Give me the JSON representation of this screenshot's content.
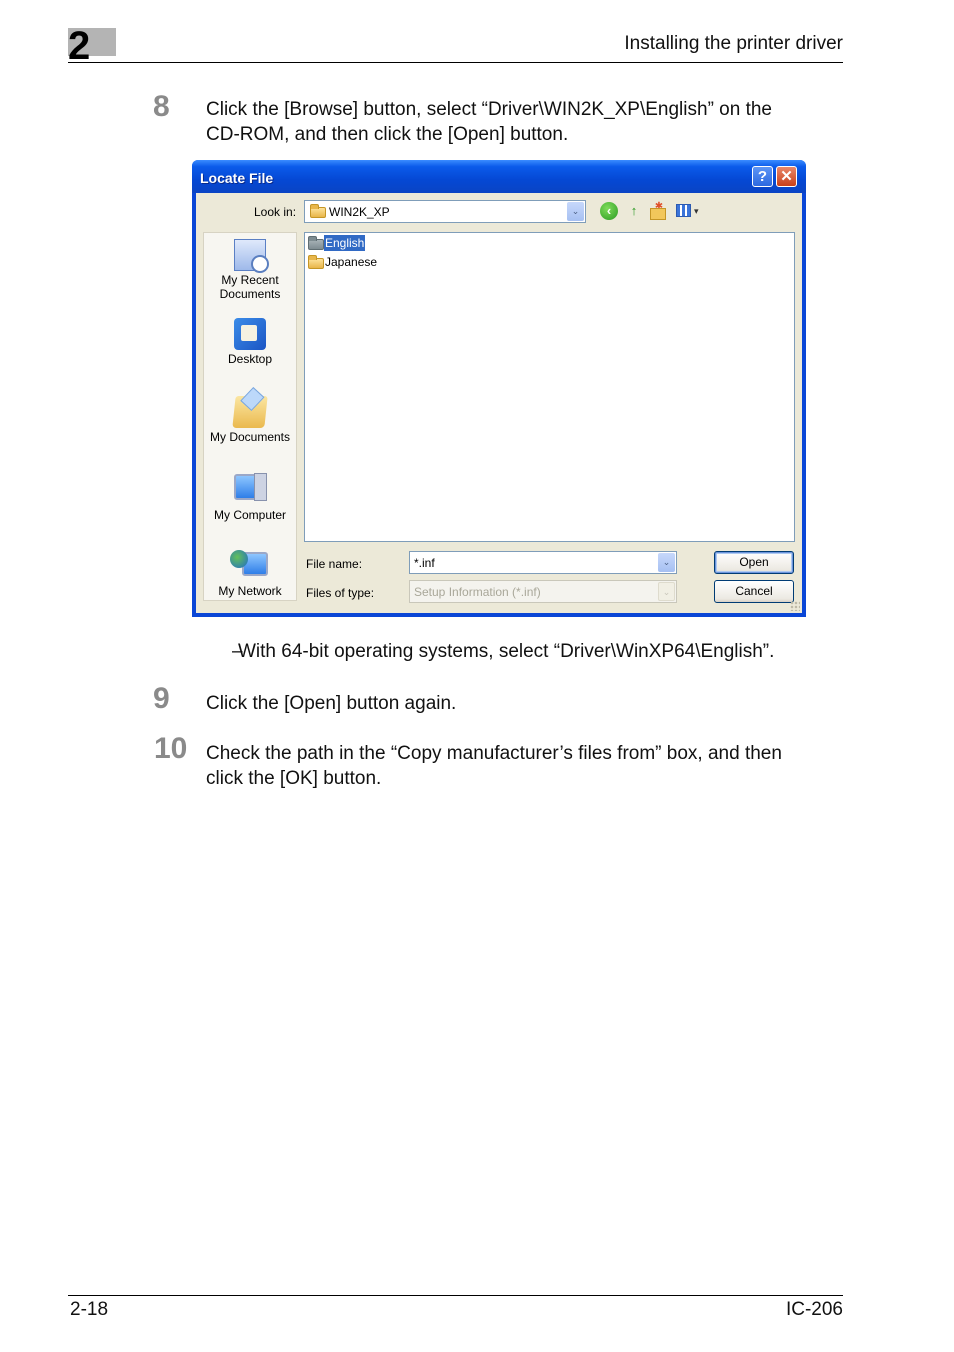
{
  "header": {
    "chapter_number": "2",
    "section_title": "Installing the printer driver"
  },
  "steps": [
    {
      "number": "8",
      "text_line1": "Click the [Browse] button, select “Driver\\WIN2K_XP\\English” on the",
      "text_line2": "CD-ROM, and then click the [Open] button."
    },
    {
      "number": "9",
      "text_line1": "Click the [Open] button again."
    },
    {
      "number": "10",
      "text_line1": "Check the path in the “Copy manufacturer’s files from” box, and then",
      "text_line2": "click the [OK] button."
    }
  ],
  "note": {
    "dash": "–",
    "text": "With 64-bit operating systems, select “Driver\\WinXP64\\English”."
  },
  "dialog": {
    "title": "Locate File",
    "help_button": "?",
    "close_button": "✕",
    "look_in_label": "Look in:",
    "look_in_value": "WIN2K_XP",
    "toolbar_icons": [
      "back-icon",
      "up-folder-icon",
      "new-folder-icon",
      "views-menu-icon"
    ],
    "places": [
      {
        "label_line1": "My Recent",
        "label_line2": "Documents",
        "icon": "recent-documents-icon"
      },
      {
        "label_line1": "Desktop",
        "icon": "desktop-icon"
      },
      {
        "label_line1": "My Documents",
        "icon": "my-documents-icon"
      },
      {
        "label_line1": "My Computer",
        "icon": "my-computer-icon"
      },
      {
        "label_line1": "My Network",
        "icon": "my-network-icon"
      }
    ],
    "files": [
      {
        "name": "English",
        "selected": true
      },
      {
        "name": "Japanese",
        "selected": false
      }
    ],
    "file_name_label": "File name:",
    "file_name_value": "*.inf",
    "file_type_label": "Files of type:",
    "file_type_value": "Setup Information (*.inf)",
    "open_button": "Open",
    "cancel_button": "Cancel",
    "dropdown_glyph": "⌄"
  },
  "footer": {
    "page_number": "2-18",
    "model": "IC-206"
  },
  "colors": {
    "titlebar_blue": "#0548d4",
    "selection_blue": "#316ac5",
    "dialog_face": "#ece9d8",
    "step_number_gray": "#8a8a8a",
    "chapter_box_gray": "#b4b4b4"
  }
}
